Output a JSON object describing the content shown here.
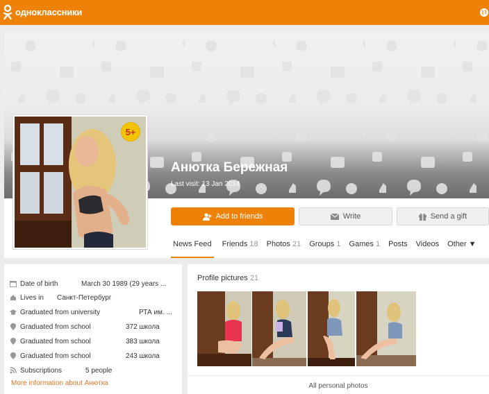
{
  "header": {
    "brand": "одноклассники",
    "accent": "#ee8208"
  },
  "profile": {
    "name": "Анютка Бережная",
    "last_visit": "Last visit: 13 Jan 2014",
    "age_badge": "5+"
  },
  "actions": {
    "add_friends": "Add to friends",
    "write": "Write",
    "send_gift": "Send a gift"
  },
  "tabs": [
    {
      "label": "News Feed",
      "count": ""
    },
    {
      "label": "Friends",
      "count": "18"
    },
    {
      "label": "Photos",
      "count": "21"
    },
    {
      "label": "Groups",
      "count": "1"
    },
    {
      "label": "Games",
      "count": "1"
    },
    {
      "label": "Posts",
      "count": ""
    },
    {
      "label": "Videos",
      "count": ""
    },
    {
      "label": "Other ▼",
      "count": ""
    }
  ],
  "info": [
    {
      "icon": "calendar-icon",
      "label": "Date of birth",
      "value": "March 30 1989 (29 years ..."
    },
    {
      "icon": "house-icon",
      "label": "Lives in",
      "value": "Санкт-Петербург"
    },
    {
      "icon": "graduation-cap-icon",
      "label": "Graduated from university",
      "value": "РТА им. ..."
    },
    {
      "icon": "location-pin-icon",
      "label": "Graduated from school",
      "value": "372 школа"
    },
    {
      "icon": "location-pin-icon",
      "label": "Graduated from school",
      "value": "383 школа"
    },
    {
      "icon": "location-pin-icon",
      "label": "Graduated from school",
      "value": "243 школа"
    },
    {
      "icon": "rss-icon",
      "label": "Subscriptions",
      "value": "5 people"
    }
  ],
  "more_info": "More information about Анютка",
  "photos": {
    "title": "Profile pictures",
    "count": "21",
    "all_link": "All personal photos"
  }
}
